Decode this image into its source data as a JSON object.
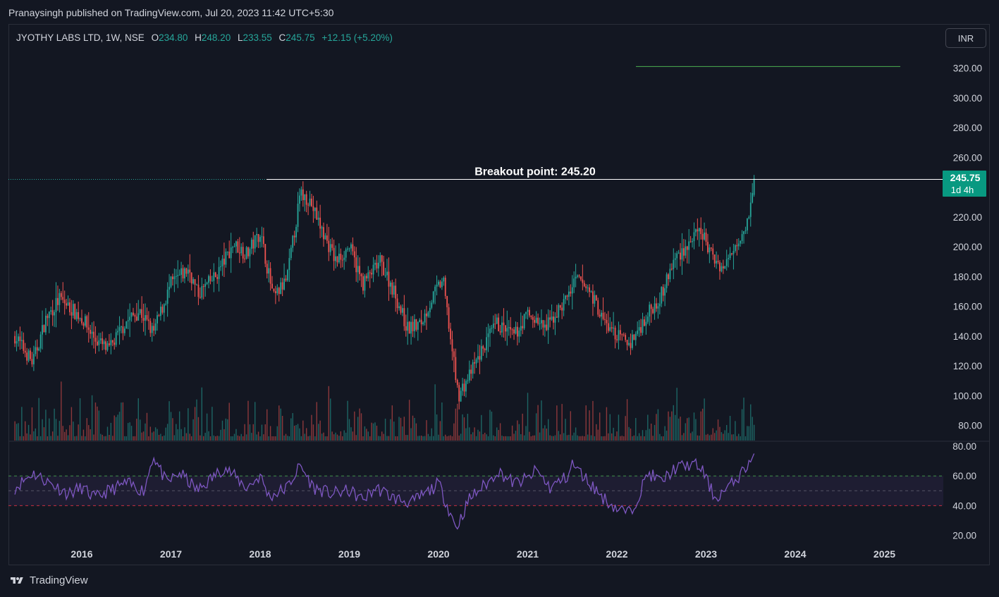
{
  "header": {
    "publisher_line": "Pranaysingh published on TradingView.com, Jul 20, 2023 11:42 UTC+5:30"
  },
  "legend": {
    "symbol": "JYOTHY LABS LTD, 1W, NSE",
    "open_label": "O",
    "open_value": "234.80",
    "high_label": "H",
    "high_value": "248.20",
    "low_label": "L",
    "low_value": "233.55",
    "close_label": "C",
    "close_value": "245.75",
    "change": "+12.15 (+5.20%)"
  },
  "currency_button": "INR",
  "annotation": {
    "text": "Breakout point: 245.20"
  },
  "price_badge": {
    "price": "245.75",
    "countdown": "1d 4h"
  },
  "footer": {
    "brand": "TradingView"
  },
  "colors": {
    "background": "#131722",
    "up": "#26a69a",
    "down": "#ef5350",
    "rsi_line": "#7e57c2",
    "target_line": "#4caf50",
    "badge": "#089981"
  },
  "chart_data": {
    "type": "candlestick",
    "symbol": "JYOTHY LABS LTD",
    "interval": "1W",
    "exchange": "NSE",
    "currency": "INR",
    "x_axis_labels": [
      "2016",
      "2017",
      "2018",
      "2019",
      "2020",
      "2021",
      "2022",
      "2023",
      "2024",
      "2025"
    ],
    "price_axis": {
      "ticks": [
        "320.00",
        "300.00",
        "280.00",
        "260.00",
        "220.00",
        "200.00",
        "180.00",
        "160.00",
        "140.00",
        "120.00",
        "100.00",
        "80.00"
      ],
      "range": [
        71,
        331
      ]
    },
    "rsi_axis": {
      "ticks": [
        "80.00",
        "60.00",
        "40.00",
        "20.00"
      ],
      "upper_band": 60,
      "mid_line": 50,
      "lower_band": 40
    },
    "last_ohlc": {
      "open": 234.8,
      "high": 248.2,
      "low": 233.55,
      "close": 245.75
    },
    "breakout_level": 245.2,
    "target_level": 321,
    "price_path": [
      [
        2015.25,
        140
      ],
      [
        2015.45,
        122
      ],
      [
        2015.6,
        152
      ],
      [
        2015.75,
        165
      ],
      [
        2016.0,
        152
      ],
      [
        2016.15,
        138
      ],
      [
        2016.3,
        130
      ],
      [
        2016.5,
        150
      ],
      [
        2016.65,
        157
      ],
      [
        2016.8,
        142
      ],
      [
        2017.0,
        175
      ],
      [
        2017.2,
        185
      ],
      [
        2017.3,
        168
      ],
      [
        2017.5,
        180
      ],
      [
        2017.7,
        202
      ],
      [
        2017.85,
        195
      ],
      [
        2018.0,
        210
      ],
      [
        2018.15,
        165
      ],
      [
        2018.3,
        178
      ],
      [
        2018.45,
        235
      ],
      [
        2018.55,
        232
      ],
      [
        2018.7,
        210
      ],
      [
        2018.85,
        190
      ],
      [
        2019.0,
        200
      ],
      [
        2019.15,
        175
      ],
      [
        2019.35,
        190
      ],
      [
        2019.5,
        170
      ],
      [
        2019.65,
        145
      ],
      [
        2019.8,
        148
      ],
      [
        2019.95,
        168
      ],
      [
        2020.05,
        178
      ],
      [
        2020.12,
        145
      ],
      [
        2020.22,
        100
      ],
      [
        2020.3,
        108
      ],
      [
        2020.5,
        132
      ],
      [
        2020.65,
        148
      ],
      [
        2020.85,
        140
      ],
      [
        2021.0,
        155
      ],
      [
        2021.2,
        145
      ],
      [
        2021.4,
        162
      ],
      [
        2021.55,
        178
      ],
      [
        2021.7,
        170
      ],
      [
        2021.85,
        150
      ],
      [
        2022.0,
        140
      ],
      [
        2022.15,
        135
      ],
      [
        2022.35,
        155
      ],
      [
        2022.5,
        168
      ],
      [
        2022.65,
        192
      ],
      [
        2022.85,
        205
      ],
      [
        2022.95,
        210
      ],
      [
        2023.05,
        195
      ],
      [
        2023.2,
        185
      ],
      [
        2023.35,
        205
      ],
      [
        2023.45,
        215
      ],
      [
        2023.52,
        235
      ],
      [
        2023.55,
        245.75
      ]
    ],
    "rsi_path": [
      [
        2015.25,
        52
      ],
      [
        2015.45,
        62
      ],
      [
        2015.65,
        55
      ],
      [
        2015.85,
        48
      ],
      [
        2016.0,
        52
      ],
      [
        2016.15,
        45
      ],
      [
        2016.3,
        50
      ],
      [
        2016.5,
        55
      ],
      [
        2016.7,
        50
      ],
      [
        2016.8,
        74
      ],
      [
        2016.95,
        55
      ],
      [
        2017.1,
        62
      ],
      [
        2017.3,
        50
      ],
      [
        2017.45,
        58
      ],
      [
        2017.6,
        66
      ],
      [
        2017.85,
        52
      ],
      [
        2018.0,
        60
      ],
      [
        2018.1,
        46
      ],
      [
        2018.3,
        52
      ],
      [
        2018.45,
        67
      ],
      [
        2018.6,
        52
      ],
      [
        2018.8,
        48
      ],
      [
        2019.0,
        50
      ],
      [
        2019.15,
        44
      ],
      [
        2019.3,
        52
      ],
      [
        2019.5,
        45
      ],
      [
        2019.7,
        42
      ],
      [
        2019.9,
        50
      ],
      [
        2020.0,
        55
      ],
      [
        2020.1,
        40
      ],
      [
        2020.2,
        25
      ],
      [
        2020.35,
        45
      ],
      [
        2020.6,
        58
      ],
      [
        2020.65,
        64
      ],
      [
        2020.85,
        55
      ],
      [
        2021.0,
        58
      ],
      [
        2021.1,
        64
      ],
      [
        2021.25,
        52
      ],
      [
        2021.45,
        60
      ],
      [
        2021.5,
        68
      ],
      [
        2021.7,
        55
      ],
      [
        2021.85,
        45
      ],
      [
        2022.0,
        38
      ],
      [
        2022.15,
        35
      ],
      [
        2022.25,
        48
      ],
      [
        2022.35,
        62
      ],
      [
        2022.5,
        56
      ],
      [
        2022.65,
        65
      ],
      [
        2022.85,
        68
      ],
      [
        2022.95,
        65
      ],
      [
        2023.1,
        45
      ],
      [
        2023.25,
        52
      ],
      [
        2023.4,
        62
      ],
      [
        2023.55,
        75
      ]
    ]
  }
}
